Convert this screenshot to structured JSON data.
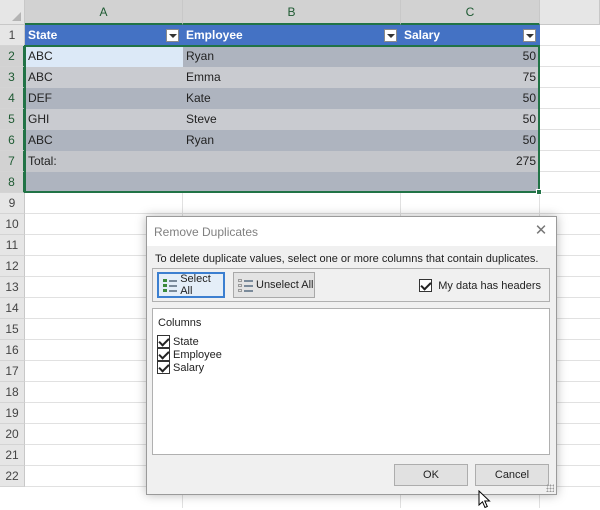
{
  "sheet": {
    "columns": [
      "A",
      "B",
      "C"
    ],
    "rows": [
      "1",
      "2",
      "3",
      "4",
      "5",
      "6",
      "7",
      "8",
      "9",
      "10",
      "11",
      "12",
      "13",
      "14",
      "15",
      "16",
      "17",
      "18",
      "19",
      "20",
      "21",
      "22"
    ],
    "headers": [
      "State",
      "Employee",
      "Salary"
    ],
    "data": [
      [
        "ABC",
        "Ryan",
        "50"
      ],
      [
        "ABC",
        "Emma",
        "75"
      ],
      [
        "DEF",
        "Kate",
        "50"
      ],
      [
        "GHI",
        "Steve",
        "50"
      ],
      [
        "ABC",
        "Ryan",
        "50"
      ]
    ],
    "total_label": "Total:",
    "total_value": "275"
  },
  "dialog": {
    "title": "Remove Duplicates",
    "instruction": "To delete duplicate values, select one or more columns that contain duplicates.",
    "select_all": "Select All",
    "unselect_all": "Unselect All",
    "my_data_has_headers": "My data has headers",
    "headers_checked": true,
    "columns_label": "Columns",
    "columns": [
      {
        "label": "State",
        "checked": true
      },
      {
        "label": "Employee",
        "checked": true
      },
      {
        "label": "Salary",
        "checked": true
      }
    ],
    "ok": "OK",
    "cancel": "Cancel"
  },
  "colors": {
    "header_blue": "#4472c4",
    "selection_green": "#217346",
    "band_dark": "#aeb4bf",
    "band_light": "#c9cbd0"
  },
  "icons": {
    "select_all": "list-check-icon",
    "unselect_all": "list-uncheck-icon",
    "close": "close-icon",
    "filter": "filter-dropdown-icon",
    "cursor": "mouse-pointer-icon"
  }
}
